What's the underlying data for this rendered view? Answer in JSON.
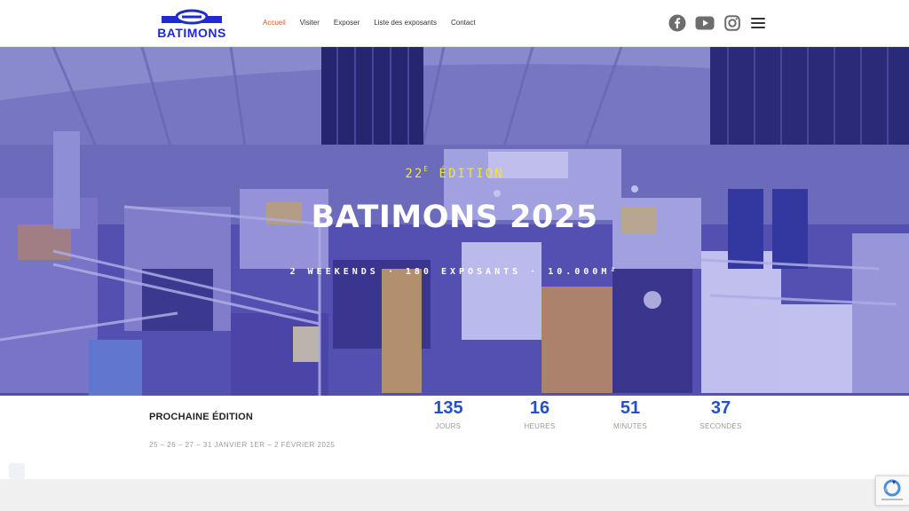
{
  "brand": {
    "name": "BATIMONS",
    "color": "#1f2ad0"
  },
  "nav": {
    "items": [
      {
        "label": "Accueil",
        "active": true
      },
      {
        "label": "Visiter",
        "active": false
      },
      {
        "label": "Exposer",
        "active": false
      },
      {
        "label": "Liste des exposants",
        "active": false
      },
      {
        "label": "Contact",
        "active": false
      }
    ],
    "active_color": "#e2532f"
  },
  "social": [
    "facebook-icon",
    "youtube-icon",
    "instagram-icon",
    "menu-icon"
  ],
  "hero": {
    "edition_number": "22",
    "edition_suffix": "E",
    "edition_word": "ÉDITION",
    "title": "BATIMONS 2025",
    "tagline": "2 WEEKENDS · 180 EXPOSANTS · 10.000M²",
    "edition_color": "#f3e23a"
  },
  "next_edition": {
    "label": "PROCHAINE ÉDITION",
    "dates": "25 – 26 – 27 – 31 JANVIER 1ER – 2 FÉVRIER 2025"
  },
  "countdown": [
    {
      "value": "135",
      "label": "JOURS"
    },
    {
      "value": "16",
      "label": "HEURES"
    },
    {
      "value": "51",
      "label": "MINUTES"
    },
    {
      "value": "37",
      "label": "SECONDES"
    }
  ],
  "countdown_color": "#2451c7"
}
